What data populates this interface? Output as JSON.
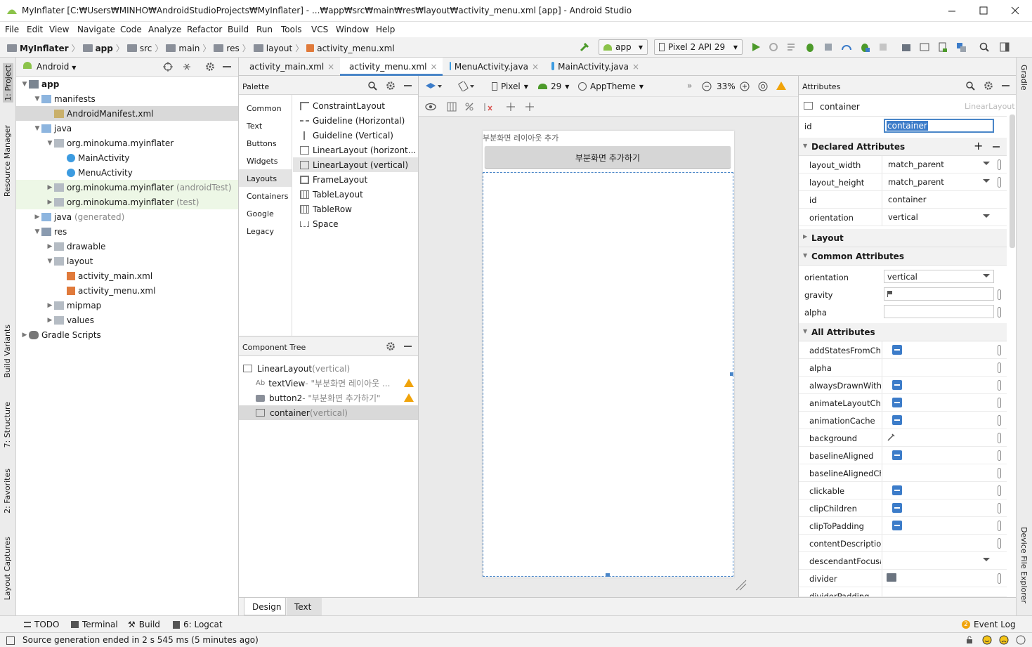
{
  "window": {
    "title": "MyInflater [C:₩Users₩MINHO₩AndroidStudioProjects₩MyInflater] - ...₩app₩src₩main₩res₩layout₩activity_menu.xml [app] - Android Studio"
  },
  "menu": [
    "File",
    "Edit",
    "View",
    "Navigate",
    "Code",
    "Analyze",
    "Refactor",
    "Build",
    "Run",
    "Tools",
    "VCS",
    "Window",
    "Help"
  ],
  "breadcrumb": [
    "MyInflater",
    "app",
    "src",
    "main",
    "res",
    "layout",
    "activity_menu.xml"
  ],
  "toolbar": {
    "config": "app",
    "device": "Pixel 2 API 29"
  },
  "left_strip": [
    "1: Project",
    "Resource Manager",
    "Build Variants",
    "7: Structure",
    "2: Favorites",
    "Layout Captures"
  ],
  "right_strip": [
    "Gradle",
    "Device File Explorer"
  ],
  "project": {
    "view": "Android",
    "tree": [
      {
        "label": "app",
        "bold": true
      },
      {
        "label": "manifests"
      },
      {
        "label": "AndroidManifest.xml"
      },
      {
        "label": "java"
      },
      {
        "label": "org.minokuma.myinflater"
      },
      {
        "label": "MainActivity"
      },
      {
        "label": "MenuActivity"
      },
      {
        "label": "org.minokuma.myinflater",
        "suffix": "(androidTest)"
      },
      {
        "label": "org.minokuma.myinflater",
        "suffix": "(test)"
      },
      {
        "label": "java",
        "suffix": "(generated)"
      },
      {
        "label": "res"
      },
      {
        "label": "drawable"
      },
      {
        "label": "layout"
      },
      {
        "label": "activity_main.xml"
      },
      {
        "label": "activity_menu.xml"
      },
      {
        "label": "mipmap"
      },
      {
        "label": "values"
      },
      {
        "label": "Gradle Scripts"
      }
    ]
  },
  "editor_tabs": [
    "activity_main.xml",
    "activity_menu.xml",
    "MenuActivity.java",
    "MainActivity.java"
  ],
  "palette": {
    "title": "Palette",
    "categories": [
      "Common",
      "Text",
      "Buttons",
      "Widgets",
      "Layouts",
      "Containers",
      "Google",
      "Legacy"
    ],
    "items": [
      "ConstraintLayout",
      "Guideline (Horizontal)",
      "Guideline (Vertical)",
      "LinearLayout (horizont...",
      "LinearLayout (vertical)",
      "FrameLayout",
      "TableLayout",
      "TableRow",
      "Space"
    ]
  },
  "component_tree": {
    "title": "Component Tree",
    "rows": [
      {
        "name": "LinearLayout",
        "detail": "(vertical)"
      },
      {
        "name": "textView",
        "detail": "- \"부분화면 레이아웃 ...",
        "warn": true
      },
      {
        "name": "button2",
        "detail": "- \"부분화면 추가하기\"",
        "warn": true
      },
      {
        "name": "container",
        "detail": "(vertical)"
      }
    ]
  },
  "design_toolbar": {
    "device": "Pixel",
    "api": "29",
    "theme": "AppTheme",
    "zoom": "33%"
  },
  "preview": {
    "text": "부분화면 레이아웃 추가",
    "button": "부분화면 추가하기"
  },
  "attributes": {
    "title": "Attributes",
    "component": "container",
    "component_type": "LinearLayout",
    "id_label": "id",
    "id_value": "container",
    "declared_title": "Declared Attributes",
    "declared": [
      {
        "k": "layout_width",
        "v": "match_parent"
      },
      {
        "k": "layout_height",
        "v": "match_parent"
      },
      {
        "k": "id",
        "v": "container"
      },
      {
        "k": "orientation",
        "v": "vertical"
      }
    ],
    "layout_title": "Layout",
    "common_title": "Common Attributes",
    "common": [
      {
        "k": "orientation",
        "v": "vertical"
      },
      {
        "k": "gravity",
        "v": ""
      },
      {
        "k": "alpha",
        "v": ""
      }
    ],
    "all_title": "All Attributes",
    "all": [
      "addStatesFromChild",
      "alpha",
      "alwaysDrawnWithCa",
      "animateLayoutChang",
      "animationCache",
      "background",
      "baselineAligned",
      "baselineAlignedChil",
      "clickable",
      "clipChildren",
      "clipToPadding",
      "contentDescription",
      "descendantFocusabi",
      "divider",
      "dividerPadding"
    ]
  },
  "bottom_tabs": [
    "Design",
    "Text"
  ],
  "tool_windows": [
    "TODO",
    "Terminal",
    "Build",
    "6: Logcat"
  ],
  "event_log": {
    "count": "2",
    "label": "Event Log"
  },
  "status": "Source generation ended in 2 s 545 ms (5 minutes ago)"
}
